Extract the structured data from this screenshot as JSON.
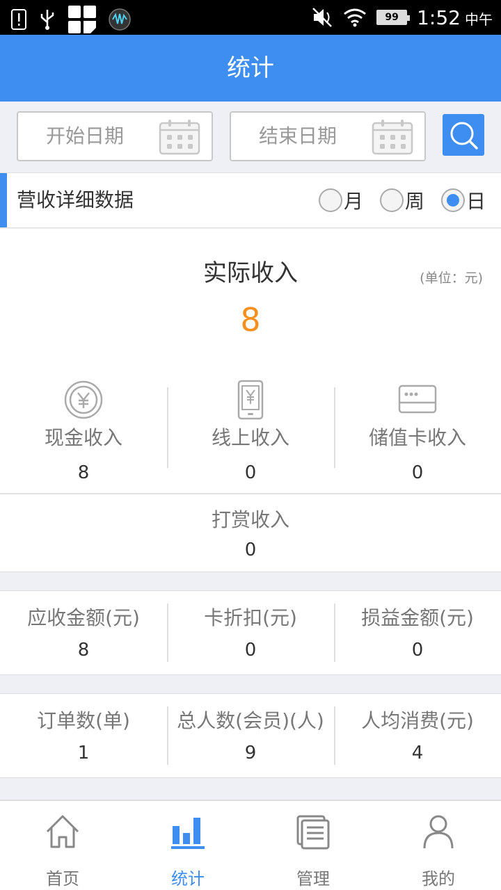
{
  "status_bar": {
    "time": "1:52",
    "ampm": "中午",
    "battery": "99"
  },
  "header": {
    "title": "统计"
  },
  "filter": {
    "start_placeholder": "开始日期",
    "end_placeholder": "结束日期"
  },
  "section": {
    "title": "营收详细数据",
    "periods": [
      {
        "label": "月",
        "selected": false
      },
      {
        "label": "周",
        "selected": false
      },
      {
        "label": "日",
        "selected": true
      }
    ]
  },
  "income": {
    "title": "实际收入",
    "unit": "(单位：元)",
    "value": "8",
    "channels": [
      {
        "label": "现金收入",
        "value": "8",
        "icon": "yuan-coin-icon"
      },
      {
        "label": "线上收入",
        "value": "0",
        "icon": "phone-payment-icon"
      },
      {
        "label": "储值卡收入",
        "value": "0",
        "icon": "stored-value-card-icon"
      }
    ],
    "tip": {
      "label": "打赏收入",
      "value": "0"
    }
  },
  "amounts": [
    {
      "label": "应收金额(元)",
      "value": "8"
    },
    {
      "label": "卡折扣(元)",
      "value": "0"
    },
    {
      "label": "损益金额(元)",
      "value": "0"
    }
  ],
  "orders": [
    {
      "label": "订单数(单)",
      "value": "1"
    },
    {
      "label": "总人数(会员)(人)",
      "value": "9"
    },
    {
      "label": "人均消费(元)",
      "value": "4"
    }
  ],
  "tabs": [
    {
      "label": "首页",
      "icon": "home-icon",
      "active": false
    },
    {
      "label": "统计",
      "icon": "bar-chart-icon",
      "active": true
    },
    {
      "label": "管理",
      "icon": "management-icon",
      "active": false
    },
    {
      "label": "我的",
      "icon": "user-icon",
      "active": false
    }
  ],
  "colors": {
    "accent": "#3d8ef0",
    "highlight": "#f5901e"
  }
}
